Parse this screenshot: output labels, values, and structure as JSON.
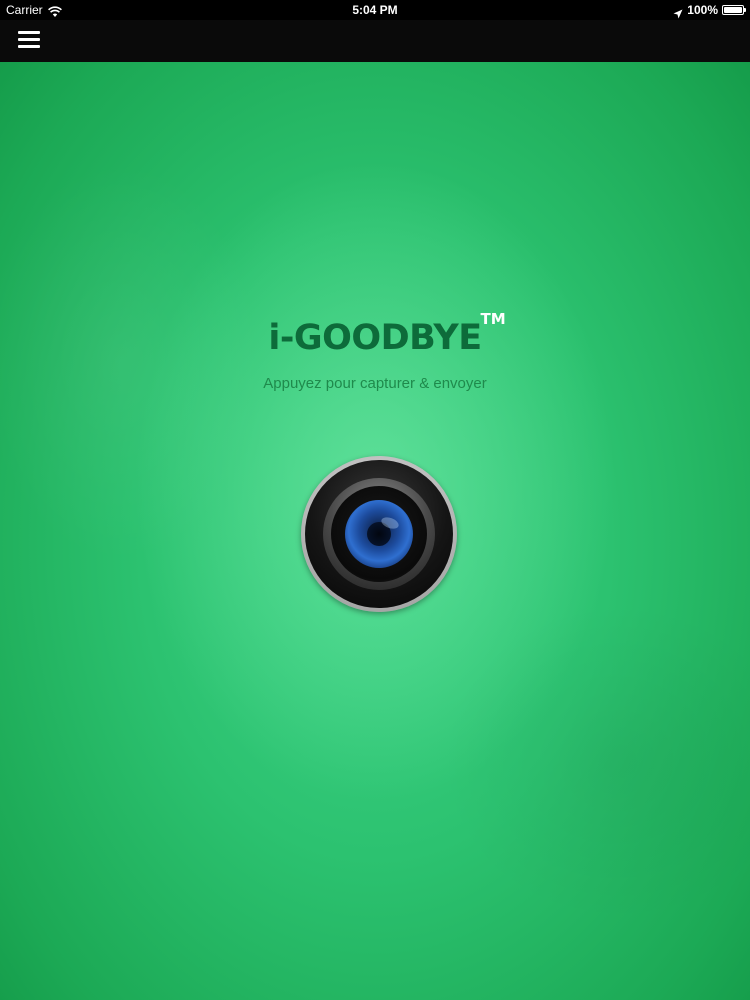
{
  "status_bar": {
    "carrier": "Carrier",
    "time": "5:04 PM",
    "battery_percent": "100%",
    "battery_level": 1.0,
    "icons": [
      "wifi-icon",
      "location-arrow-icon",
      "battery-icon"
    ]
  },
  "nav_bar": {
    "menu_icon": "hamburger-menu-icon"
  },
  "main": {
    "logo": "i-GOODBYE",
    "trademark": "TM",
    "tagline": "Appuyez pour capturer & envoyer",
    "capture_icon": "camera-lens-icon"
  },
  "colors": {
    "background_green": "#2cc270",
    "logo_green": "#0d6b3a",
    "tagline_green": "#1f8a4c",
    "bar_black": "#0a0a0a",
    "lens_blue": "#1d4c9e"
  }
}
